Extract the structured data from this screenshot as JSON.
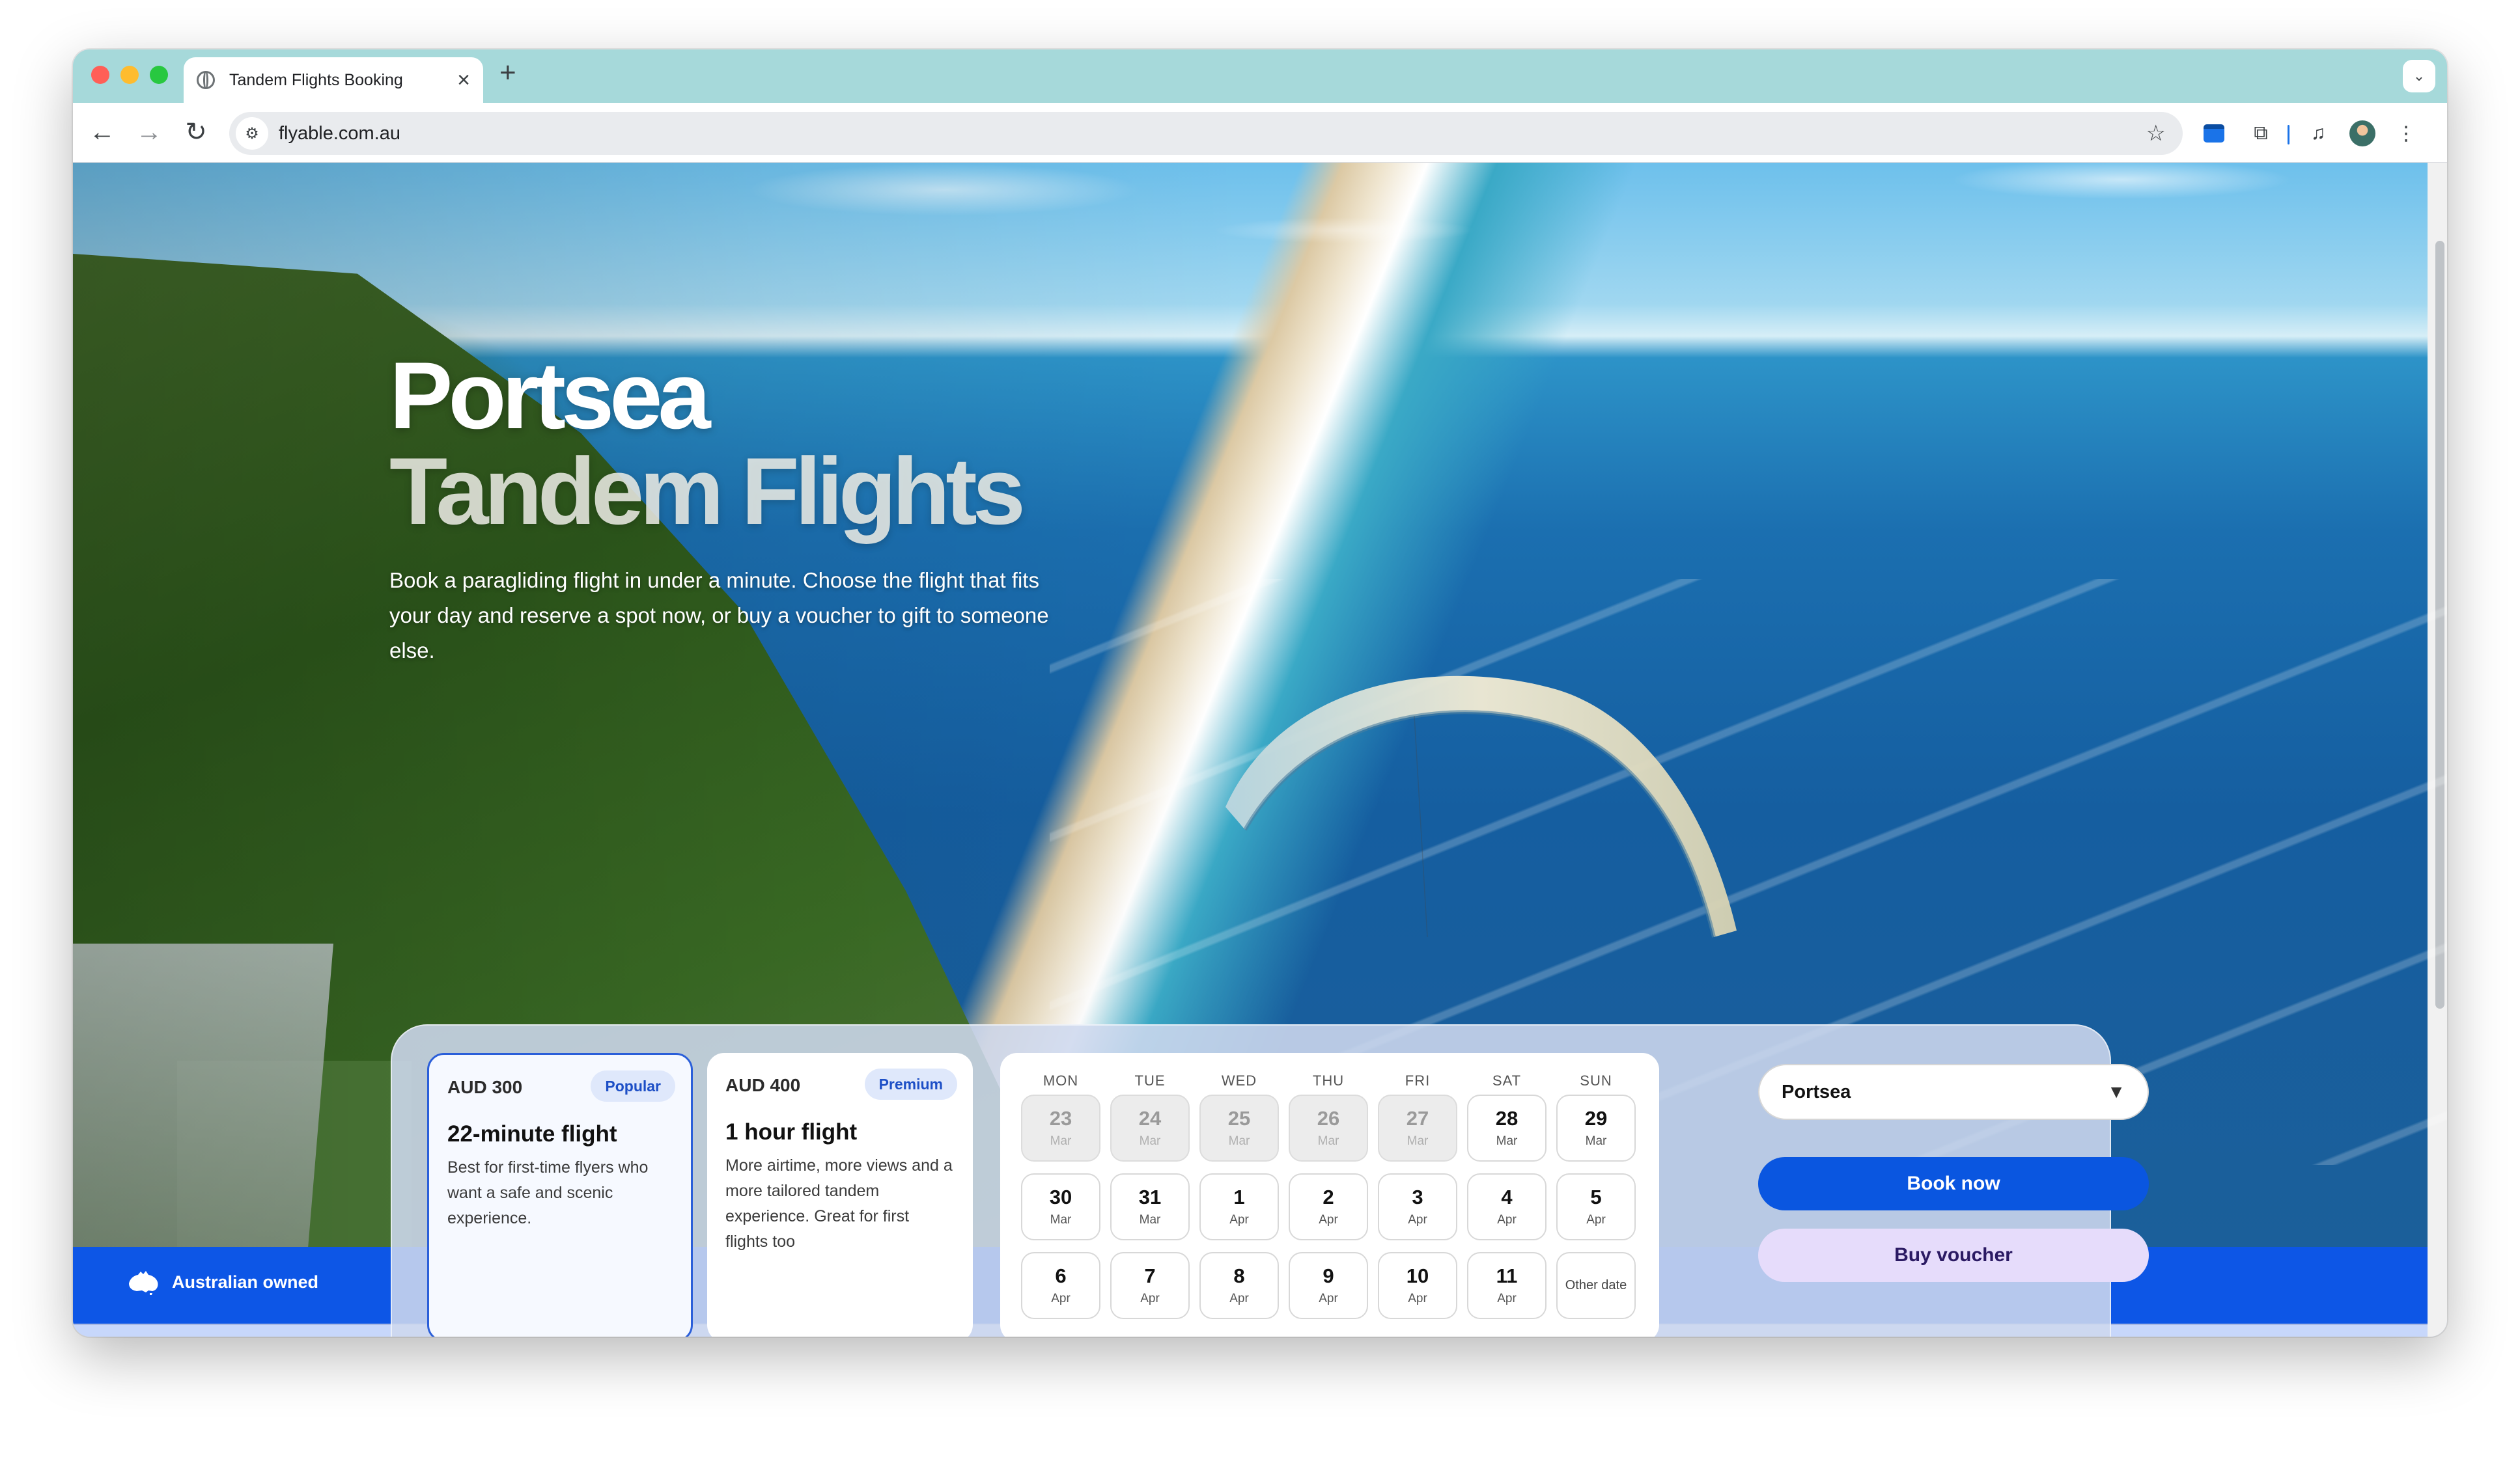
{
  "browser": {
    "tab_title": "Tandem Flights Booking",
    "url": "flyable.com.au"
  },
  "hero": {
    "title_line1": "Portsea",
    "title_line2": "Tandem Flights",
    "description": "Book a paragliding flight in under a minute. Choose the flight that fits your day and reserve a spot now, or buy a voucher to gift to someone else."
  },
  "footer_badge": "Australian owned",
  "flights": [
    {
      "price": "AUD 300",
      "badge": "Popular",
      "name": "22-minute flight",
      "description": "Best for first-time flyers who want a safe and scenic experience.",
      "selected": true
    },
    {
      "price": "AUD 400",
      "badge": "Premium",
      "name": "1 hour flight",
      "description": "More airtime, more views and a more tailored tandem experience. Great for first flights too",
      "selected": false
    }
  ],
  "calendar": {
    "weekdays": [
      "MON",
      "TUE",
      "WED",
      "THU",
      "FRI",
      "SAT",
      "SUN"
    ],
    "days": [
      {
        "num": "23",
        "month": "Mar",
        "state": "past"
      },
      {
        "num": "24",
        "month": "Mar",
        "state": "past"
      },
      {
        "num": "25",
        "month": "Mar",
        "state": "past"
      },
      {
        "num": "26",
        "month": "Mar",
        "state": "past"
      },
      {
        "num": "27",
        "month": "Mar",
        "state": "past"
      },
      {
        "num": "28",
        "month": "Mar",
        "state": "available"
      },
      {
        "num": "29",
        "month": "Mar",
        "state": "available"
      },
      {
        "num": "30",
        "month": "Mar",
        "state": "available"
      },
      {
        "num": "31",
        "month": "Mar",
        "state": "available"
      },
      {
        "num": "1",
        "month": "Apr",
        "state": "available"
      },
      {
        "num": "2",
        "month": "Apr",
        "state": "available"
      },
      {
        "num": "3",
        "month": "Apr",
        "state": "available"
      },
      {
        "num": "4",
        "month": "Apr",
        "state": "available"
      },
      {
        "num": "5",
        "month": "Apr",
        "state": "available"
      },
      {
        "num": "6",
        "month": "Apr",
        "state": "available"
      },
      {
        "num": "7",
        "month": "Apr",
        "state": "available"
      },
      {
        "num": "8",
        "month": "Apr",
        "state": "available"
      },
      {
        "num": "9",
        "month": "Apr",
        "state": "available"
      },
      {
        "num": "10",
        "month": "Apr",
        "state": "available"
      },
      {
        "num": "11",
        "month": "Apr",
        "state": "available"
      }
    ],
    "other_date": "Other date"
  },
  "location_select": {
    "selected": "Portsea"
  },
  "actions": {
    "book_now": "Book now",
    "buy_voucher": "Buy voucher"
  },
  "colors": {
    "tab_strip": "#a6d9da",
    "primary_blue": "#0a56e0",
    "voucher_lavender": "#e6dcfb",
    "band_blue": "#0d56e6"
  },
  "icons": {
    "close_tab": "close-icon",
    "new_tab": "plus-icon",
    "back": "arrow-left-icon",
    "forward": "arrow-right-icon",
    "reload": "reload-icon",
    "bookmark": "star-icon",
    "dropdown": "caret-down-icon",
    "australia": "australia-map-icon"
  }
}
